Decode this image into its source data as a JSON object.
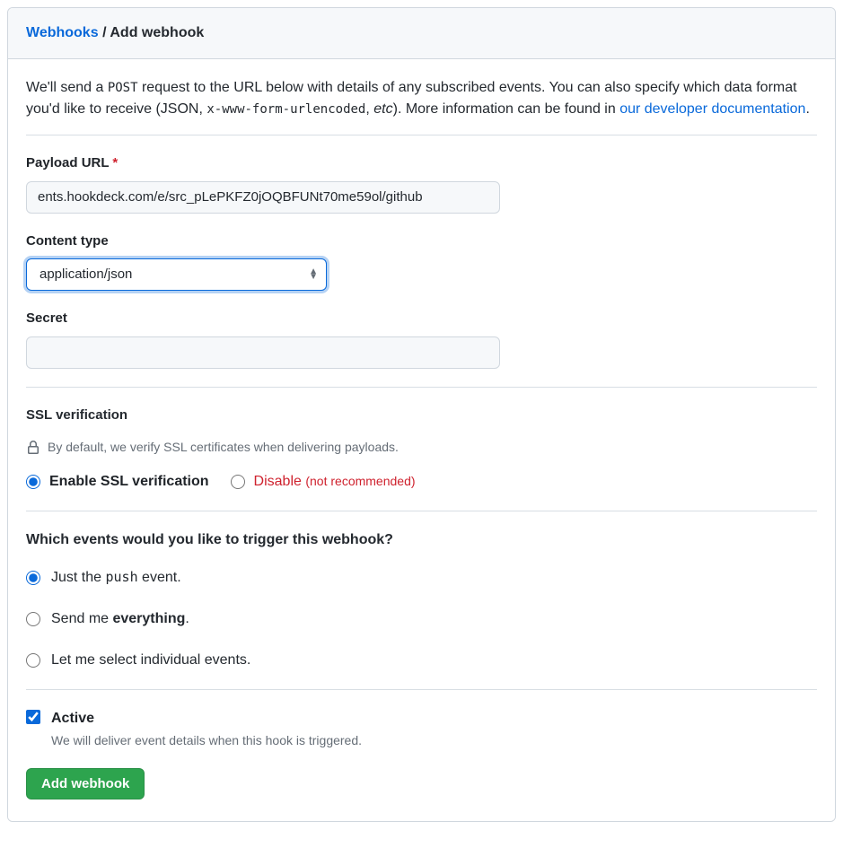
{
  "breadcrumb": {
    "parent": "Webhooks",
    "sep": "/",
    "current": "Add webhook"
  },
  "intro": {
    "part1": "We'll send a ",
    "code1": "POST",
    "part2": " request to the URL below with details of any subscribed events. You can also specify which data format you'd like to receive (JSON, ",
    "code2": "x-www-form-urlencoded",
    "part3": ", ",
    "italic": "etc",
    "part4": "). More information can be found in ",
    "link": "our developer documentation",
    "part5": "."
  },
  "form": {
    "payload_url": {
      "label": "Payload URL",
      "required": "*",
      "value": "ents.hookdeck.com/e/src_pLePKFZ0jOQBFUNt70me59ol/github"
    },
    "content_type": {
      "label": "Content type",
      "value": "application/json"
    },
    "secret": {
      "label": "Secret",
      "value": ""
    }
  },
  "ssl": {
    "heading": "SSL verification",
    "note": "By default, we verify SSL certificates when delivering payloads.",
    "enable": "Enable SSL verification",
    "disable": "Disable",
    "disable_note": "(not recommended)"
  },
  "events": {
    "heading": "Which events would you like to trigger this webhook?",
    "push_a": "Just the ",
    "push_code": "push",
    "push_b": " event.",
    "everything_a": "Send me ",
    "everything_bold": "everything",
    "everything_b": ".",
    "individual": "Let me select individual events."
  },
  "active": {
    "label": "Active",
    "sub": "We will deliver event details when this hook is triggered."
  },
  "submit": {
    "label": "Add webhook"
  }
}
